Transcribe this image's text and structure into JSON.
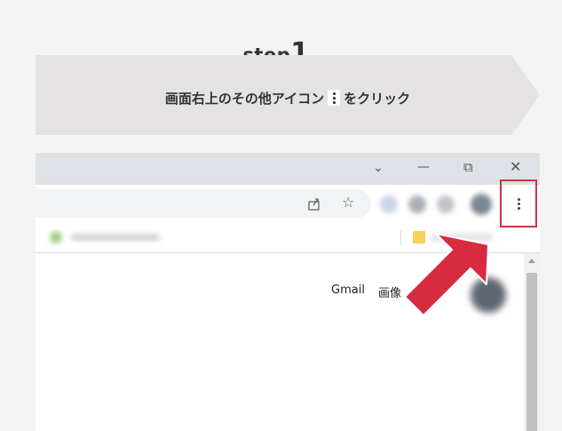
{
  "step": {
    "word": "step",
    "number": "1."
  },
  "instruction": {
    "before": "画面右上のその他アイコン",
    "after": "をクリック"
  },
  "browser": {
    "window_controls": {
      "dropdown": "⌄",
      "minimize": "—",
      "restore": "⧉",
      "close": "✕"
    },
    "links": {
      "gmail": "Gmail",
      "images": "画像"
    }
  },
  "colors": {
    "highlight": "#d0313f",
    "arrow": "#d92b40",
    "banner": "#e4e2e2"
  }
}
